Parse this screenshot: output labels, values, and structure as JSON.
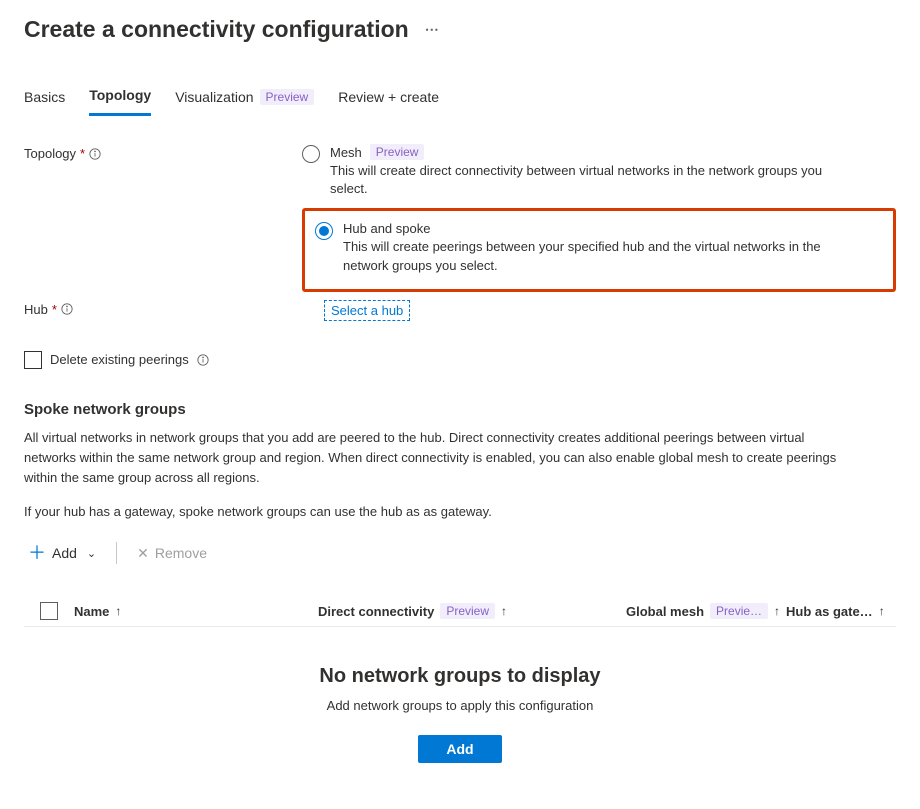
{
  "header": {
    "title": "Create a connectivity configuration"
  },
  "tabs": {
    "basics": "Basics",
    "topology": "Topology",
    "visualization": "Visualization",
    "visualization_badge": "Preview",
    "review": "Review + create"
  },
  "topology": {
    "label": "Topology",
    "mesh": {
      "label": "Mesh",
      "badge": "Preview",
      "desc": "This will create direct connectivity between virtual networks in the network groups you select."
    },
    "hubspoke": {
      "label": "Hub and spoke",
      "desc": "This will create peerings between your specified hub and the virtual networks in the network groups you select."
    }
  },
  "hub": {
    "label": "Hub",
    "link": "Select a hub"
  },
  "delete_peerings": {
    "label": "Delete existing peerings"
  },
  "spoke": {
    "heading": "Spoke network groups",
    "desc1": "All virtual networks in network groups that you add are peered to the hub. Direct connectivity creates additional peerings between virtual networks within the same network group and region. When direct connectivity is enabled, you can also enable global mesh to create peerings within the same group across all regions.",
    "desc2": "If your hub has a gateway, spoke network groups can use the hub as as gateway."
  },
  "toolbar": {
    "add": "Add",
    "remove": "Remove"
  },
  "table": {
    "name": "Name",
    "direct": "Direct connectivity",
    "direct_badge": "Preview",
    "global": "Global mesh",
    "global_badge": "Previe…",
    "hub_col": "Hub as gate…"
  },
  "empty": {
    "title": "No network groups to display",
    "sub": "Add network groups to apply this configuration",
    "button": "Add"
  }
}
